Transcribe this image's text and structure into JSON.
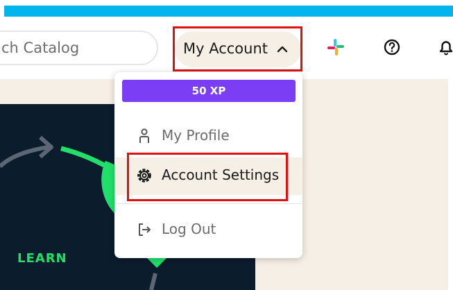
{
  "header": {
    "search_placeholder": "ch Catalog",
    "account_label": "My Account",
    "icons": [
      "slack-icon",
      "help-icon",
      "bell-icon"
    ]
  },
  "menu": {
    "xp_badge": "50 XP",
    "items": [
      {
        "label": "My Profile",
        "icon": "person-icon"
      },
      {
        "label": "Account Settings",
        "icon": "gear-icon"
      },
      {
        "label": "Log Out",
        "icon": "logout-icon"
      }
    ]
  },
  "hero": {
    "learn_label": "LEARN"
  },
  "colors": {
    "accent_cyan": "#04b4ec",
    "xp_purple": "#7b3ef5",
    "highlight_red": "#e01010",
    "hero_dark": "#0b1c2c",
    "hero_green": "#21e06a",
    "beige": "#f6efe6"
  }
}
